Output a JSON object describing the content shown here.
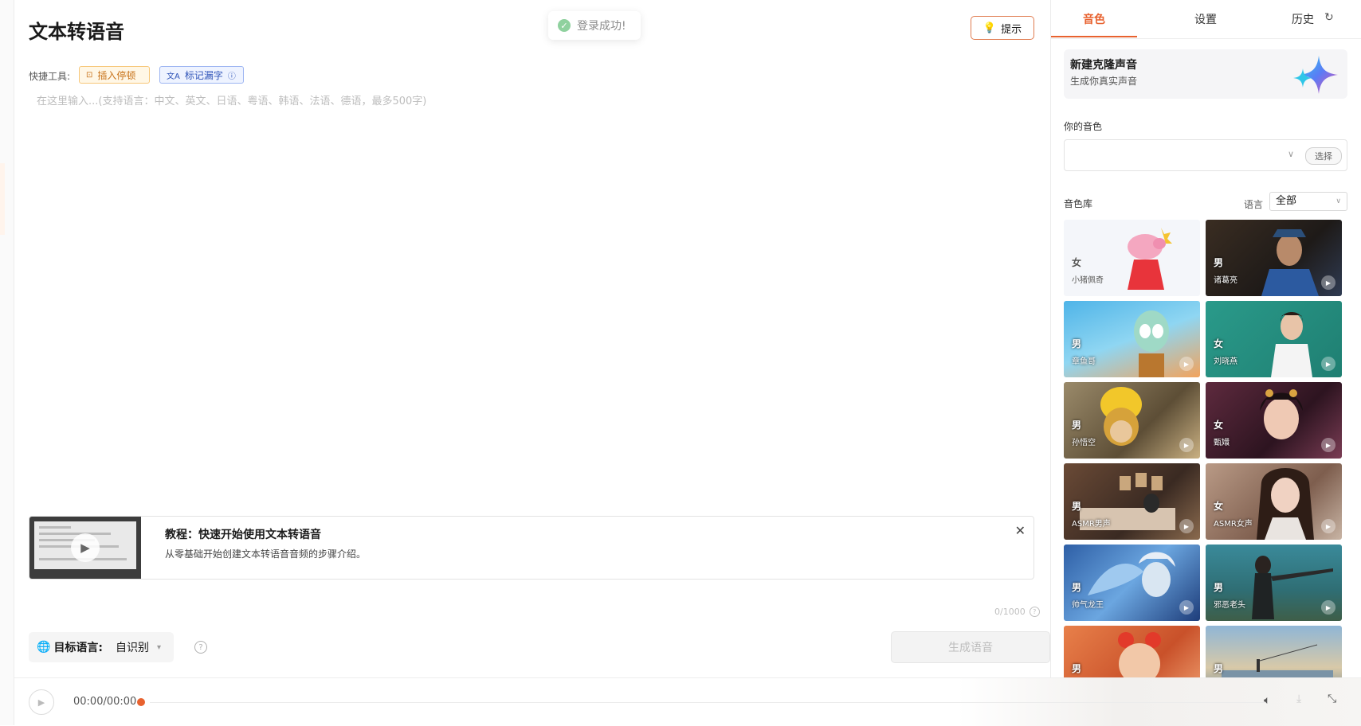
{
  "page": {
    "title": "文本转语音"
  },
  "toast": {
    "text": "登录成功!"
  },
  "header": {
    "tip_label": "提示"
  },
  "tools": {
    "label": "快捷工具:",
    "insert_pause": "插入停顿",
    "mark_missing": "标记漏字"
  },
  "editor": {
    "placeholder": "在这里输入...(支持语言：中文、英文、日语、粤语、韩语、法语、德语，最多500字)",
    "value": ""
  },
  "tutorial": {
    "title": "教程：快速开始使用文本转语音",
    "description": "从零基础开始创建文本转语音音频的步骤介绍。"
  },
  "counter": {
    "text": "0/1000"
  },
  "target_language": {
    "label": "目标语言:",
    "value": "自识别"
  },
  "generate": {
    "label": "生成语音"
  },
  "player": {
    "time": "00:00/00:00",
    "progress": 0
  },
  "sidebar": {
    "tabs": [
      "音色",
      "设置",
      "历史"
    ],
    "active_tab": "音色",
    "clone": {
      "title": "新建克隆声音",
      "subtitle": "生成你真实声音"
    },
    "my_voice_label": "你的音色",
    "my_voice_value": "",
    "select_label": "选择",
    "library_label": "音色库",
    "library_lang_label": "语言",
    "library_lang_value": "全部",
    "voices": [
      {
        "gender": "女",
        "name": "小猪佩奇"
      },
      {
        "gender": "男",
        "name": "诸葛亮"
      },
      {
        "gender": "男",
        "name": "章鱼哥"
      },
      {
        "gender": "女",
        "name": "刘晓燕"
      },
      {
        "gender": "男",
        "name": "孙悟空"
      },
      {
        "gender": "女",
        "name": "甄嬛"
      },
      {
        "gender": "男",
        "name": "ASMR男声"
      },
      {
        "gender": "女",
        "name": "ASMR女声"
      },
      {
        "gender": "男",
        "name": "帅气龙王"
      },
      {
        "gender": "男",
        "name": "邪恶老头"
      },
      {
        "gender": "男",
        "name": ""
      },
      {
        "gender": "男",
        "name": ""
      }
    ]
  },
  "colors": {
    "accent": "#e8622f",
    "success": "#8fd19e",
    "link_blue": "#2f54b8"
  }
}
